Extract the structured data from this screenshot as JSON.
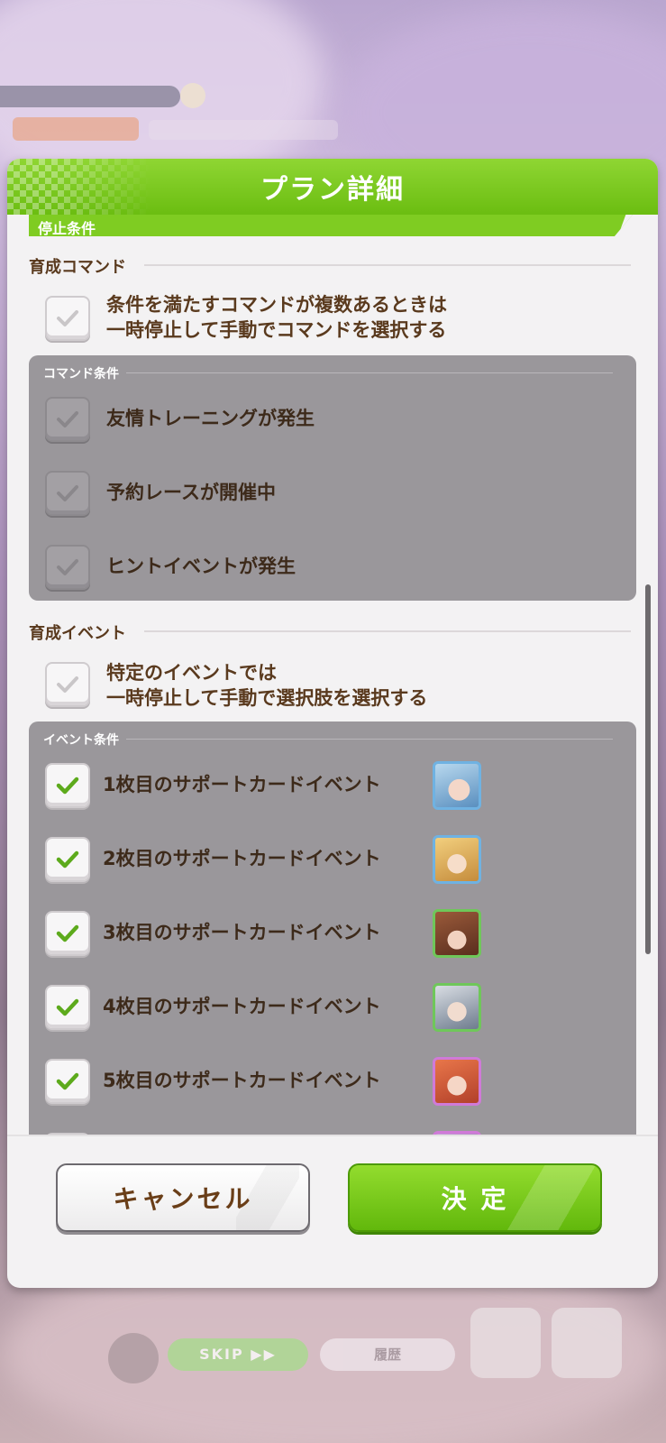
{
  "modal": {
    "title": "プラン詳細",
    "section_title": "停止条件"
  },
  "command_group": {
    "label": "育成コマンド",
    "master_option_line1": "条件を満たすコマンドが複数あるときは",
    "master_option_line2": "一時停止して手動でコマンドを選択する",
    "master_checked": true,
    "panel_label": "コマンド条件",
    "conditions": [
      {
        "label": "友情トレーニングが発生",
        "checked": true,
        "enabled": false
      },
      {
        "label": "予約レースが開催中",
        "checked": true,
        "enabled": false
      },
      {
        "label": "ヒントイベントが発生",
        "checked": true,
        "enabled": false
      }
    ]
  },
  "event_group": {
    "label": "育成イベント",
    "master_option_line1": "特定のイベントでは",
    "master_option_line2": "一時停止して手動で選択肢を選択する",
    "master_checked": true,
    "panel_label": "イベント条件",
    "conditions": [
      {
        "label": "1枚目のサポートカードイベント",
        "checked": true,
        "icon": "support-card-1-icon",
        "frame": "#6fb2e2"
      },
      {
        "label": "2枚目のサポートカードイベント",
        "checked": true,
        "icon": "support-card-2-icon",
        "frame": "#6fb2e2"
      },
      {
        "label": "3枚目のサポートカードイベント",
        "checked": true,
        "icon": "support-card-3-icon",
        "frame": "#6fc75a"
      },
      {
        "label": "4枚目のサポートカードイベント",
        "checked": true,
        "icon": "support-card-4-icon",
        "frame": "#6fc75a"
      },
      {
        "label": "5枚目のサポートカードイベント",
        "checked": true,
        "icon": "support-card-5-icon",
        "frame": "#d07ad8"
      }
    ]
  },
  "buttons": {
    "cancel": "キャンセル",
    "confirm": "決 定"
  },
  "background": {
    "skip_label": "SKIP ▶▶",
    "log_label": "履歴"
  },
  "colors": {
    "accent_green": "#6bbd11",
    "text_brown": "#5a3a1e",
    "check_green": "#5daa1c"
  }
}
